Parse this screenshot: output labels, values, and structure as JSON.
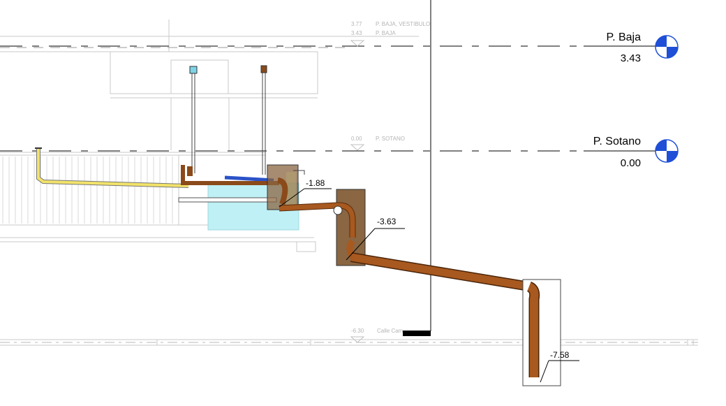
{
  "levels": {
    "baja": {
      "name": "P. Baja",
      "elevation": "3.43"
    },
    "sotano": {
      "name": "P. Sotano",
      "elevation": "0.00"
    }
  },
  "faint_labels": {
    "vestibulo": {
      "elev": "3.77",
      "name": "P. BAJA, VESTIBULO"
    },
    "baja": {
      "elev": "3.43",
      "name": "P. BAJA"
    },
    "sotano": {
      "elev": "0.00",
      "name": "P. SOTANO"
    },
    "calle": {
      "elev": "-6.30",
      "name": "Calle Cam"
    }
  },
  "spot_elevations": {
    "a": "-1.88",
    "b": "-3.63",
    "c": "-7.58"
  },
  "colors": {
    "level_marker_blue": "#1f4fd6",
    "pipe_brown": "#8b4a1a",
    "tank_cyan": "#bff0f5",
    "manhole_brown": "#8a6642",
    "yellow_pipe": "#f2e36a"
  }
}
